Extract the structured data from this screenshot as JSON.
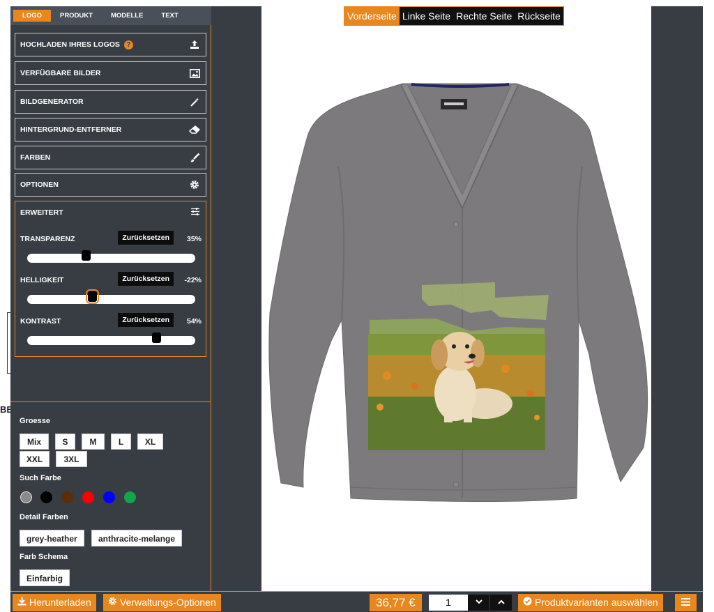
{
  "tabs": [
    "LOGO",
    "PRODUKT",
    "MODELLE",
    "TEXT"
  ],
  "sections": {
    "upload": "HOCHLADEN IHRES LOGOS",
    "help_mark": "?",
    "images": "VERFÜGBARE BILDER",
    "generator": "BILDGENERATOR",
    "bg_remover": "HINTERGRUND-ENTFERNER",
    "colors": "FARBEN",
    "options": "OPTIONEN",
    "advanced": "ERWEITERT"
  },
  "sliders": [
    {
      "label": "TRANSPARENZ",
      "reset": "Zurücksetzen",
      "value_text": "35%",
      "value": 0.35
    },
    {
      "label": "HELLIGKEIT",
      "reset": "Zurücksetzen",
      "value_text": "-22%",
      "value": 0.39
    },
    {
      "label": "KONTRAST",
      "reset": "Zurücksetzen",
      "value_text": "54%",
      "value": 0.77
    }
  ],
  "sizes": {
    "label": "Groesse",
    "items": [
      "Mix",
      "S",
      "M",
      "L",
      "XL",
      "XXL",
      "3XL"
    ]
  },
  "search_color": {
    "label": "Such Farbe",
    "swatches": [
      {
        "name": "grey",
        "hex": "#8a8a8a"
      },
      {
        "name": "black",
        "hex": "#000000"
      },
      {
        "name": "brown",
        "hex": "#5a2d0c"
      },
      {
        "name": "red",
        "hex": "#ff0000"
      },
      {
        "name": "blue",
        "hex": "#0000ff"
      },
      {
        "name": "green",
        "hex": "#13a54b"
      }
    ]
  },
  "detail_colors": {
    "label": "Detail Farben",
    "items": [
      "grey-heather",
      "anthracite-melange"
    ]
  },
  "color_scheme": {
    "label": "Farb Schema",
    "items": [
      "Einfarbig"
    ]
  },
  "views": [
    "Vorderseite",
    "Linke Seite",
    "Rechte Seite",
    "Rückseite"
  ],
  "bottom": {
    "download": "Herunterladen",
    "admin": "Verwaltungs-Optionen",
    "price": "36,77 €",
    "quantity": "1",
    "variants": "Produktvarianten auswählen"
  },
  "background_fragments": {
    "left_text": "BE"
  },
  "colors": {
    "accent": "#e8871e",
    "panel": "#383d43",
    "sweater": "#7d7a7e"
  }
}
